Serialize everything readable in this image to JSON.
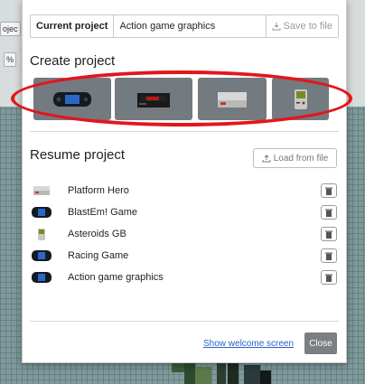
{
  "background": {
    "chip_left": "ojec",
    "chip_left2": "%"
  },
  "modal": {
    "current_project_label": "Current project",
    "current_project_value": "Action game graphics",
    "save_label": "Save to file",
    "create_title": "Create project",
    "create_consoles": [
      "game-gear-icon",
      "mega-drive-icon",
      "nes-icon",
      "game-boy-icon"
    ],
    "resume_title": "Resume project",
    "load_label": "Load from file",
    "projects": [
      {
        "name": "Platform Hero",
        "icon": "nes-icon"
      },
      {
        "name": "BlastEm! Game",
        "icon": "game-gear-icon"
      },
      {
        "name": "Asteroids GB",
        "icon": "game-boy-icon"
      },
      {
        "name": "Racing Game",
        "icon": "game-gear-icon"
      },
      {
        "name": "Action game graphics",
        "icon": "game-gear-icon"
      }
    ],
    "welcome_link": "Show welcome screen",
    "close_label": "Close"
  },
  "colors": {
    "highlight": "#e2161c",
    "button_bg": "#737a80",
    "link": "#2a62c9"
  }
}
